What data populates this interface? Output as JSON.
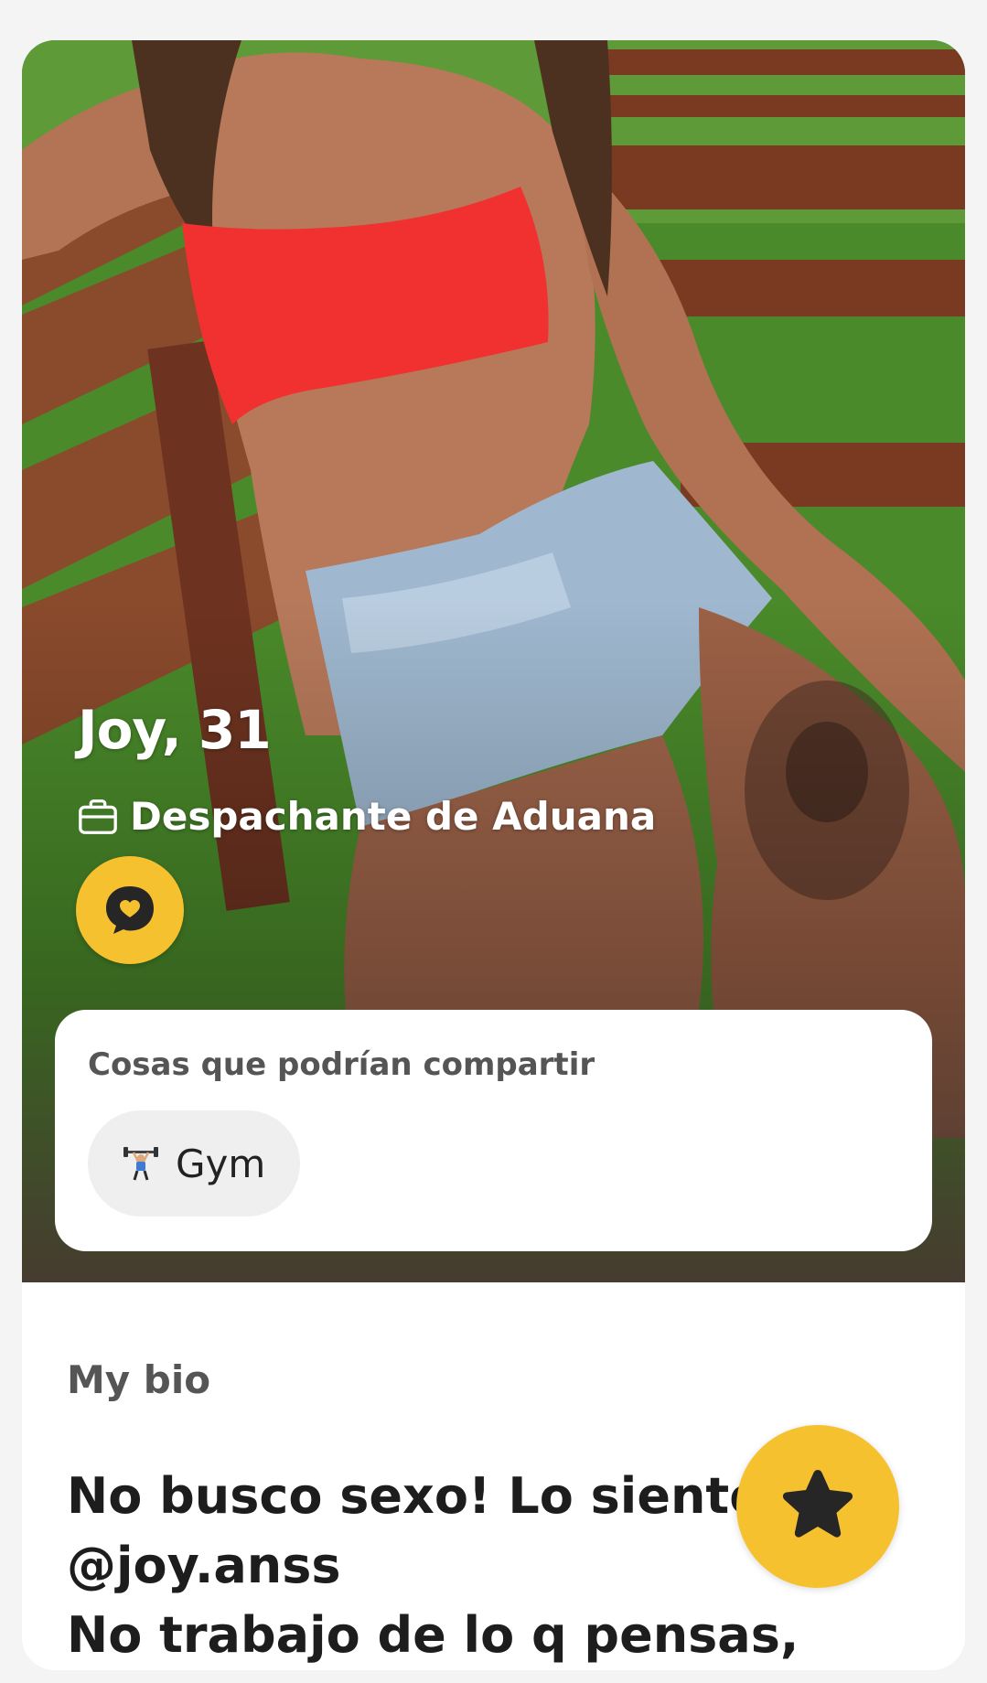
{
  "profile": {
    "name_age": "Joy, 31",
    "job": "Despachante de Aduana",
    "photo_alt": "profile-photo"
  },
  "shared": {
    "title": "Cosas que podrían compartir",
    "chips": [
      {
        "label": "Gym",
        "icon": "weightlifter-icon"
      }
    ]
  },
  "bio": {
    "heading": "My bio",
    "text": "No busco sexo! Lo siento\n@joy.anss\nNo trabajo de lo q pensas, no"
  },
  "actions": {
    "compliment_icon": "chat-heart-icon",
    "superswipe_icon": "star-icon"
  },
  "colors": {
    "accent": "#f5c12e",
    "text_dark": "#1d1d1d",
    "text_muted": "#555555",
    "chip_bg": "#efefef"
  }
}
